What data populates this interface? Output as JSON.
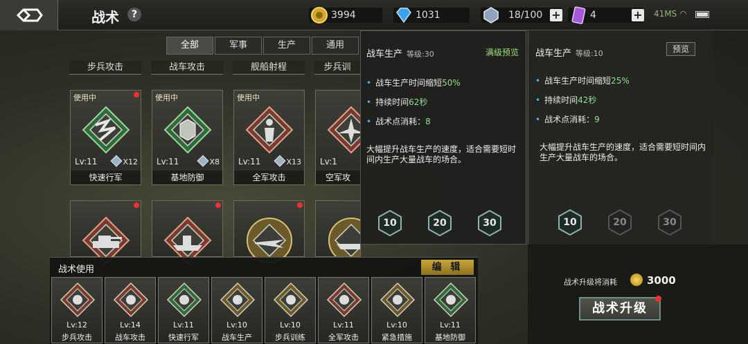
{
  "header": {
    "title": "战术",
    "help": "?",
    "resources": [
      {
        "icon": "gold-coin-icon",
        "value": "3994"
      },
      {
        "icon": "diamond-icon",
        "value": "1031"
      },
      {
        "icon": "crystal-icon",
        "value": "18/100"
      },
      {
        "icon": "card-icon",
        "value": "4"
      }
    ],
    "status": "41MS"
  },
  "tabs": [
    "全部",
    "军事",
    "生产",
    "通用"
  ],
  "categories": [
    "步兵攻击",
    "战车攻击",
    "舰船射程",
    "步兵训"
  ],
  "cards_row1": [
    {
      "in_use": "使用中",
      "level": "Lv:11",
      "count": "X12",
      "name": "快速行军",
      "emblem": "fast-march-emblem-icon"
    },
    {
      "in_use": "使用中",
      "level": "Lv:11",
      "count": "X8",
      "name": "基地防御",
      "emblem": "base-defense-emblem-icon"
    },
    {
      "in_use": "使用中",
      "level": "Lv:11",
      "count": "X13",
      "name": "全军攻击",
      "emblem": "all-army-attack-emblem-icon"
    },
    {
      "in_use": "",
      "level": "Lv:1",
      "count": "",
      "name": "空军攻",
      "emblem": "air-force-attack-emblem-icon"
    }
  ],
  "cards_row2": [
    {
      "emblem": "tank-emblem-icon"
    },
    {
      "emblem": "warship-emblem-icon"
    },
    {
      "emblem": "jet-emblem-icon"
    },
    {
      "emblem": "ship-gear-emblem-icon"
    }
  ],
  "tooltip": {
    "title": "战车生产",
    "level_label": "等级:30",
    "preview": "满级预览",
    "lines": [
      {
        "text": "战车生产时间缩短",
        "value": "50%"
      },
      {
        "text": "持续时间",
        "value": "62秒"
      },
      {
        "text": "战术点消耗：",
        "value": "8"
      }
    ],
    "desc": "大幅提升战车生产的速度，适合需要短时间内生产大量战车的场合。",
    "levels": [
      "10",
      "20",
      "30"
    ]
  },
  "detail": {
    "title": "战车生产",
    "level_label": "等级:10",
    "preview": "预览",
    "lines": [
      {
        "text": "战车生产时间缩短",
        "value": "25%"
      },
      {
        "text": "持续时间",
        "value": "42秒"
      },
      {
        "text": "战术点消耗：",
        "value": "9"
      }
    ],
    "desc": "大幅提升战车生产的速度，适合需要短时间内生产大量战车的场合。",
    "levels": [
      "10",
      "20",
      "30"
    ],
    "cost_label": "战术升级将消耗",
    "cost_value": "3000",
    "upgrade": "战术升级"
  },
  "usage": {
    "label": "战术使用",
    "edit": "编 辑",
    "items": [
      {
        "level": "Lv:12",
        "name": "步兵攻击",
        "emblem": "infantry-attack-emblem-icon",
        "color": "#7a3a2e"
      },
      {
        "level": "Lv:14",
        "name": "战车攻击",
        "emblem": "tank-attack-emblem-icon",
        "color": "#7a3a2e"
      },
      {
        "level": "Lv:11",
        "name": "快速行军",
        "emblem": "fast-march-emblem-icon",
        "color": "#2f6b3a"
      },
      {
        "level": "Lv:10",
        "name": "战车生产",
        "emblem": "tank-production-emblem-icon",
        "color": "#6d5a2a"
      },
      {
        "level": "Lv:10",
        "name": "步兵训练",
        "emblem": "infantry-training-emblem-icon",
        "color": "#6d5a2a"
      },
      {
        "level": "Lv:11",
        "name": "全军攻击",
        "emblem": "all-army-attack-emblem-icon",
        "color": "#7a3a2e"
      },
      {
        "level": "Lv:10",
        "name": "紧急措施",
        "emblem": "emergency-emblem-icon",
        "color": "#6d5a2a"
      },
      {
        "level": "Lv:11",
        "name": "基地防御",
        "emblem": "base-defense-emblem-icon",
        "color": "#2f6b3a"
      }
    ]
  }
}
